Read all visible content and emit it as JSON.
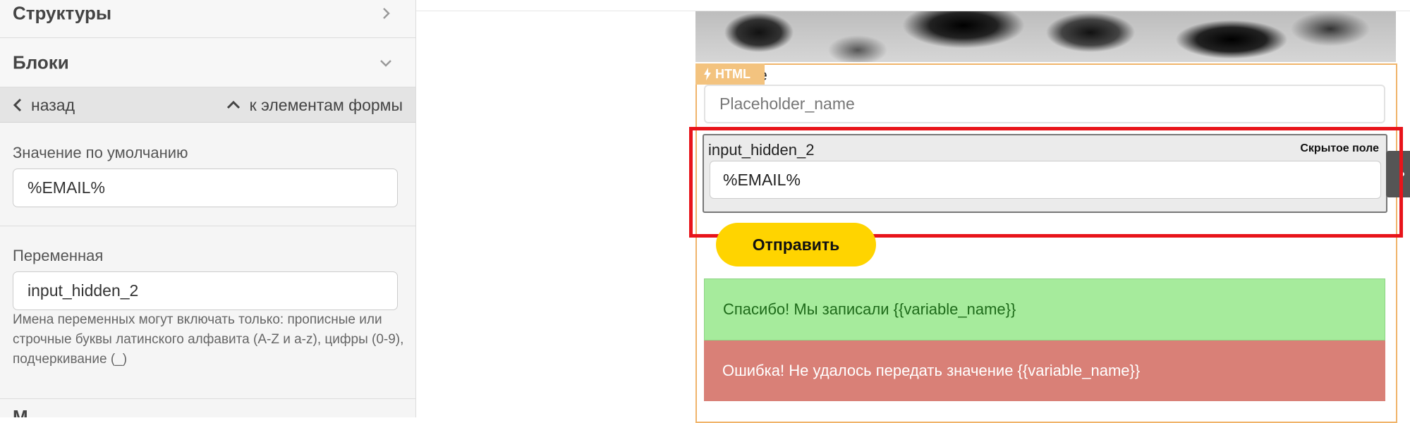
{
  "sidebar": {
    "sections": [
      {
        "title": "Структуры"
      },
      {
        "title": "Блоки"
      }
    ],
    "nav": {
      "back_label": "назад",
      "up_label": "к элементам формы"
    },
    "default_value": {
      "label": "Значение по умолчанию",
      "value": "%EMAIL%"
    },
    "variable": {
      "label": "Переменная",
      "value": "input_hidden_2",
      "help": "Имена переменных могут включать только: прописные или строчные буквы латинского алфавита (A-Z и a-z), цифры (0-9), подчеркивание (_)"
    },
    "next_section_peek": "М"
  },
  "canvas": {
    "html_badge": "HTML",
    "name_label_tail": "ame",
    "name_placeholder": "Placeholder_name",
    "hidden_field": {
      "name": "input_hidden_2",
      "type_label": "Скрытое поле",
      "value": "%EMAIL%"
    },
    "submit_label": "Отправить",
    "success_message": "Спасибо! Мы записали {{variable_name}}",
    "error_message": "Ошибка! Не удалось передать значение {{variable_name}}"
  },
  "colors": {
    "highlight": "#e8141a",
    "submit_button": "#ffd400",
    "success_bg": "#a6eb9c",
    "error_bg": "#d98077",
    "form_border": "#f0b46a"
  },
  "icons": [
    "chevron-right-icon",
    "chevron-down-icon",
    "chevron-left-icon",
    "chevron-up-icon",
    "lightning-icon",
    "drag-dots-icon"
  ]
}
